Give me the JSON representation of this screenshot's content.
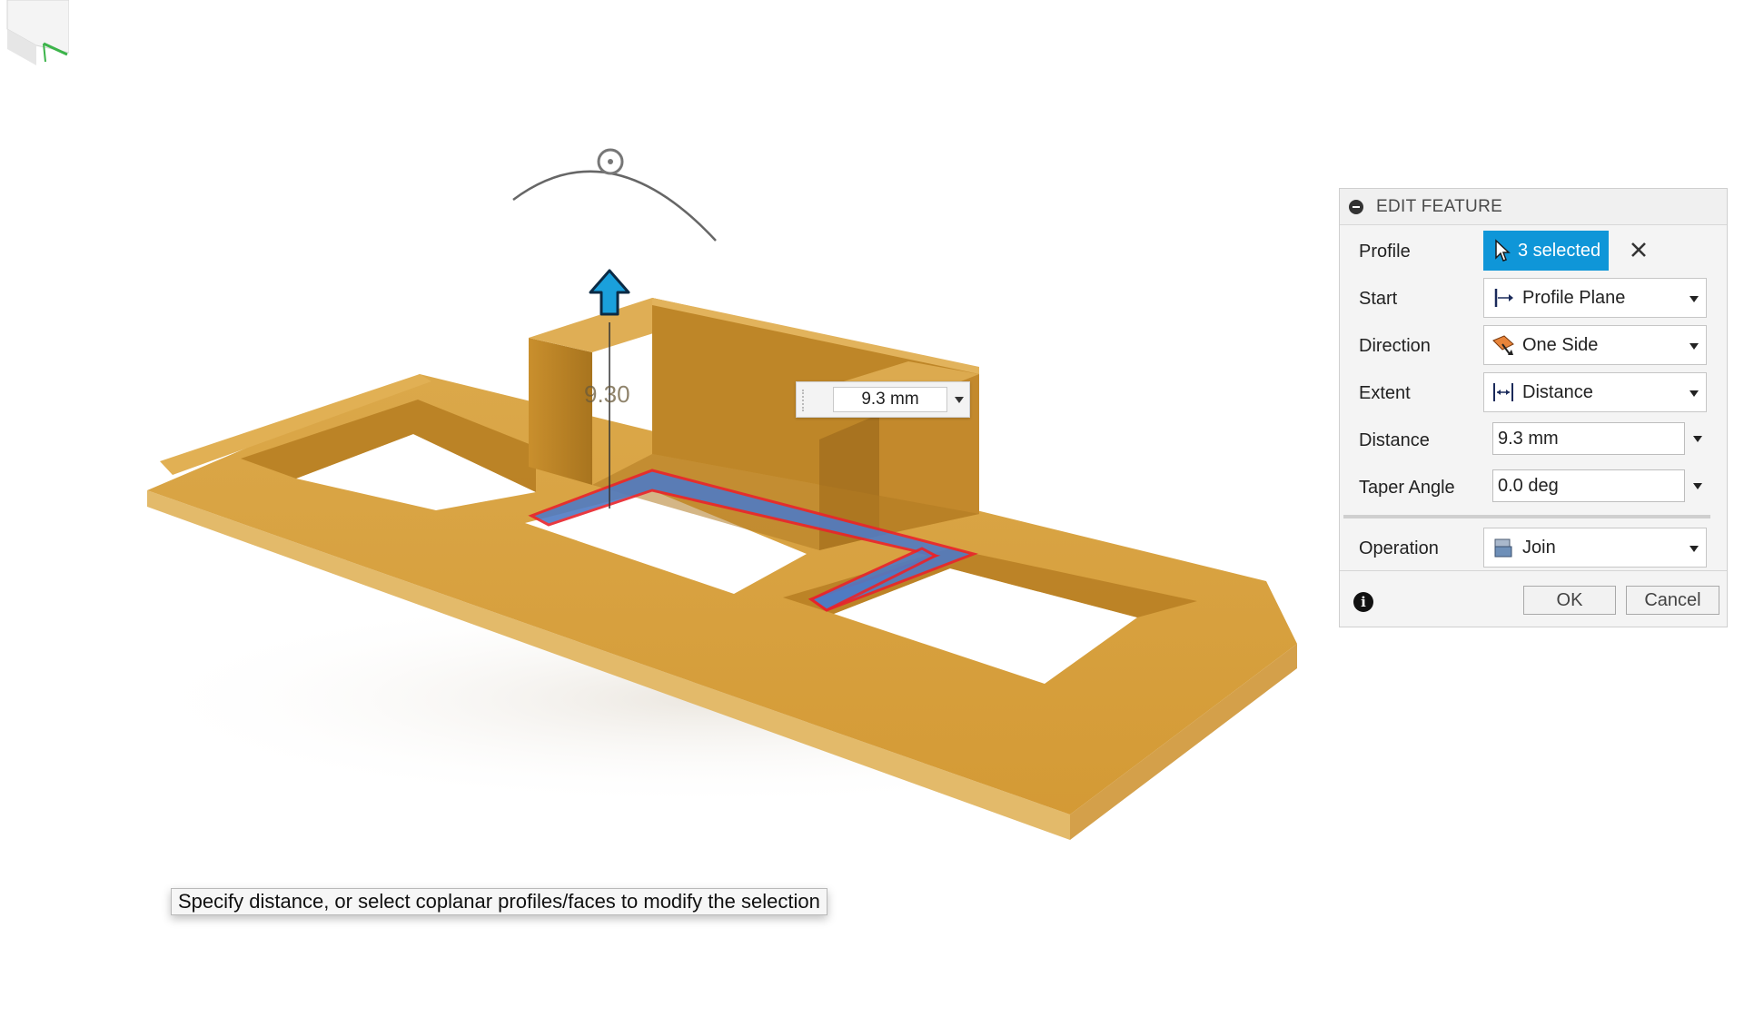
{
  "viewport": {
    "dimension_label": "9.30",
    "inline_distance_value": "9.3 mm",
    "status_hint": "Specify distance, or select coplanar profiles/faces to modify the selection"
  },
  "panel": {
    "title": "EDIT FEATURE",
    "rows": {
      "profile": {
        "label": "Profile",
        "value": "3 selected"
      },
      "start": {
        "label": "Start",
        "value": "Profile Plane"
      },
      "direction": {
        "label": "Direction",
        "value": "One Side"
      },
      "extent": {
        "label": "Extent",
        "value": "Distance"
      },
      "distance": {
        "label": "Distance",
        "value": "9.3 mm"
      },
      "taper_angle": {
        "label": "Taper Angle",
        "value": "0.0 deg"
      },
      "operation": {
        "label": "Operation",
        "value": "Join"
      }
    },
    "ok_label": "OK",
    "cancel_label": "Cancel"
  },
  "colors": {
    "model": "#d9a441",
    "selection_fill": "#4f7bc4",
    "selection_edge": "#e8242c",
    "accent": "#0f96d8"
  }
}
